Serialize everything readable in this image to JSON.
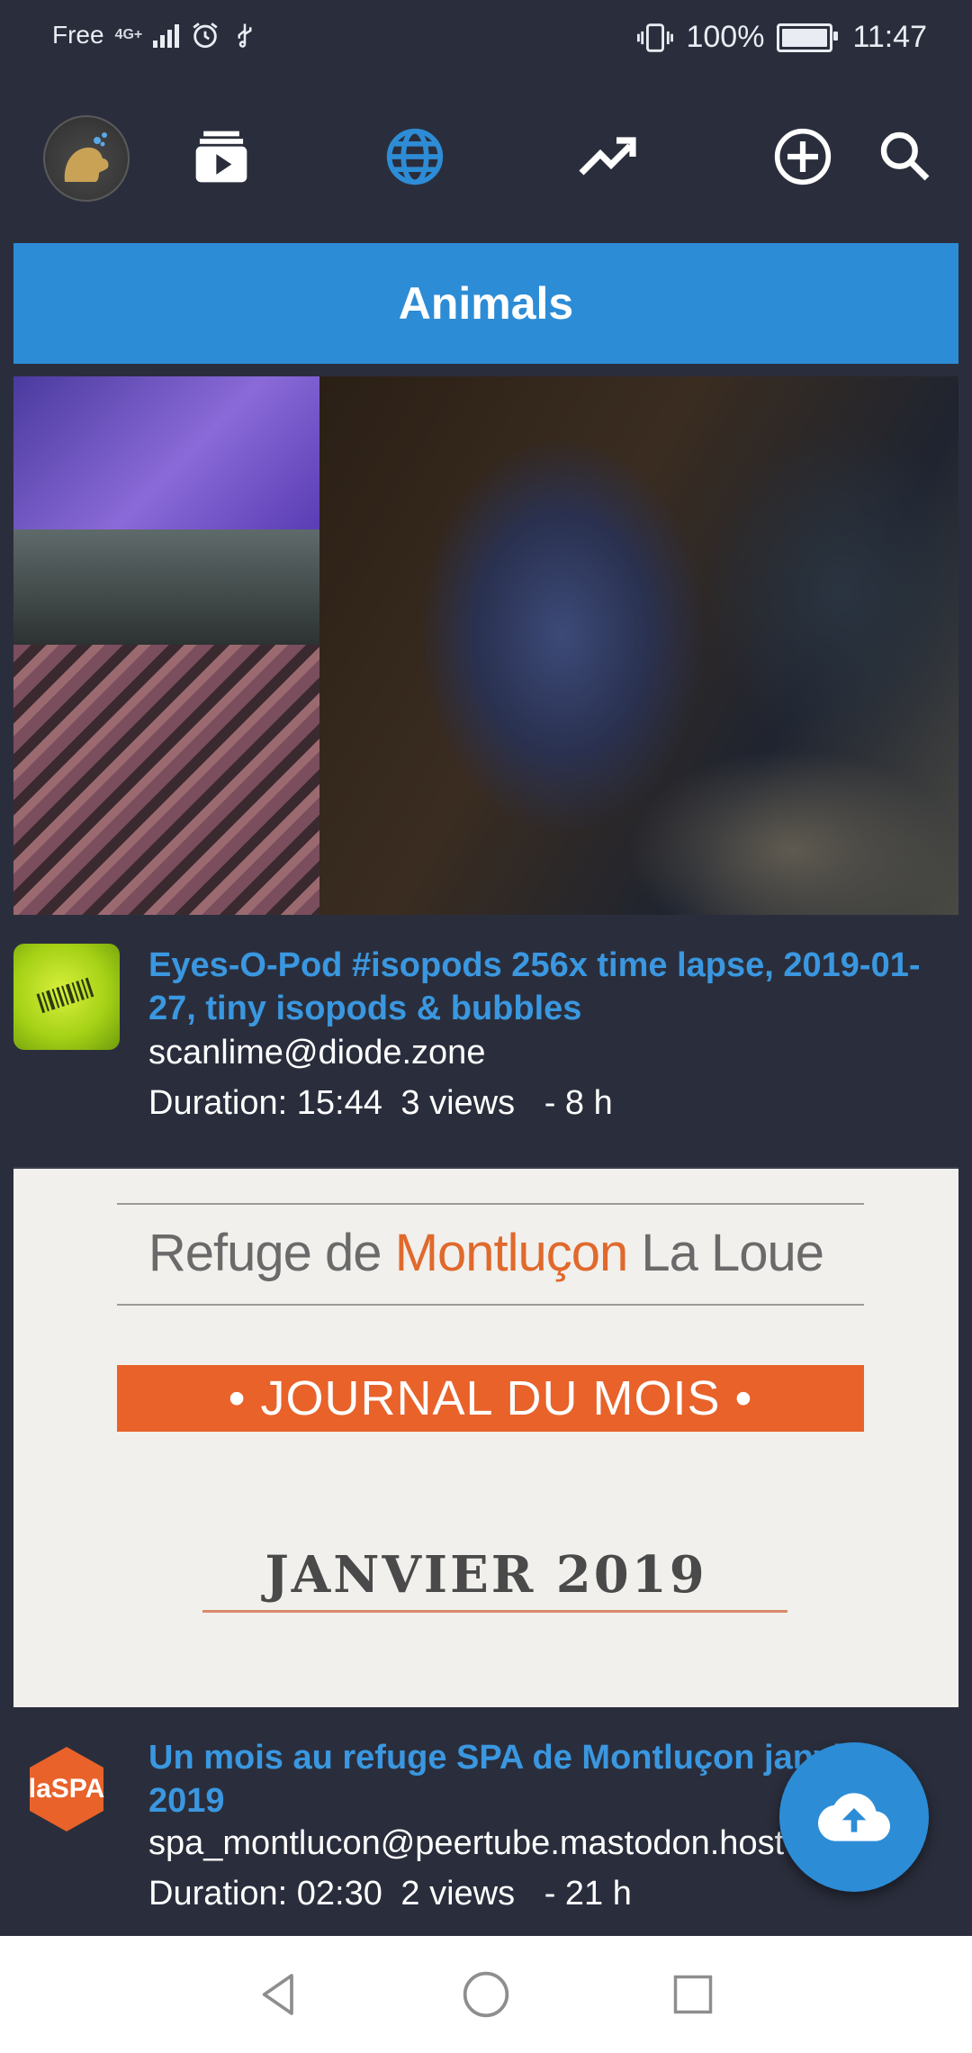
{
  "status_bar": {
    "carrier": "Free",
    "network": "4G+",
    "battery": "100%",
    "time": "11:47"
  },
  "app_bar": {
    "icons": [
      "avatar",
      "subscriptions-icon",
      "globe-icon",
      "trending-icon",
      "add-circle-icon",
      "search-icon"
    ],
    "accent": "#2d8cd6"
  },
  "category": {
    "title": "Animals"
  },
  "videos": [
    {
      "title": "Eyes-O-Pod #isopods 256x time lapse, 2019-01-27, tiny isopods & bubbles",
      "channel": "scanlime@diode.zone",
      "duration": "Duration: 15:44",
      "views": "3 views",
      "age": "- 8 h"
    },
    {
      "thumbnail": {
        "line1_a": "Refuge de ",
        "line1_b": "Montluçon",
        "line1_c": " La Loue",
        "band": "• JOURNAL DU MOIS •",
        "date": "JANVIER 2019"
      },
      "avatar_text": "laSPA",
      "title": "Un mois au refuge SPA de Montluçon janvier 2019",
      "channel": "spa_montlucon@peertube.mastodon.host",
      "duration": "Duration: 02:30",
      "views": "2 views",
      "age": "- 21 h"
    }
  ],
  "fab": {
    "icon": "cloud-upload-icon"
  },
  "nav": {
    "icons": [
      "back-icon",
      "home-icon",
      "recents-icon"
    ]
  }
}
